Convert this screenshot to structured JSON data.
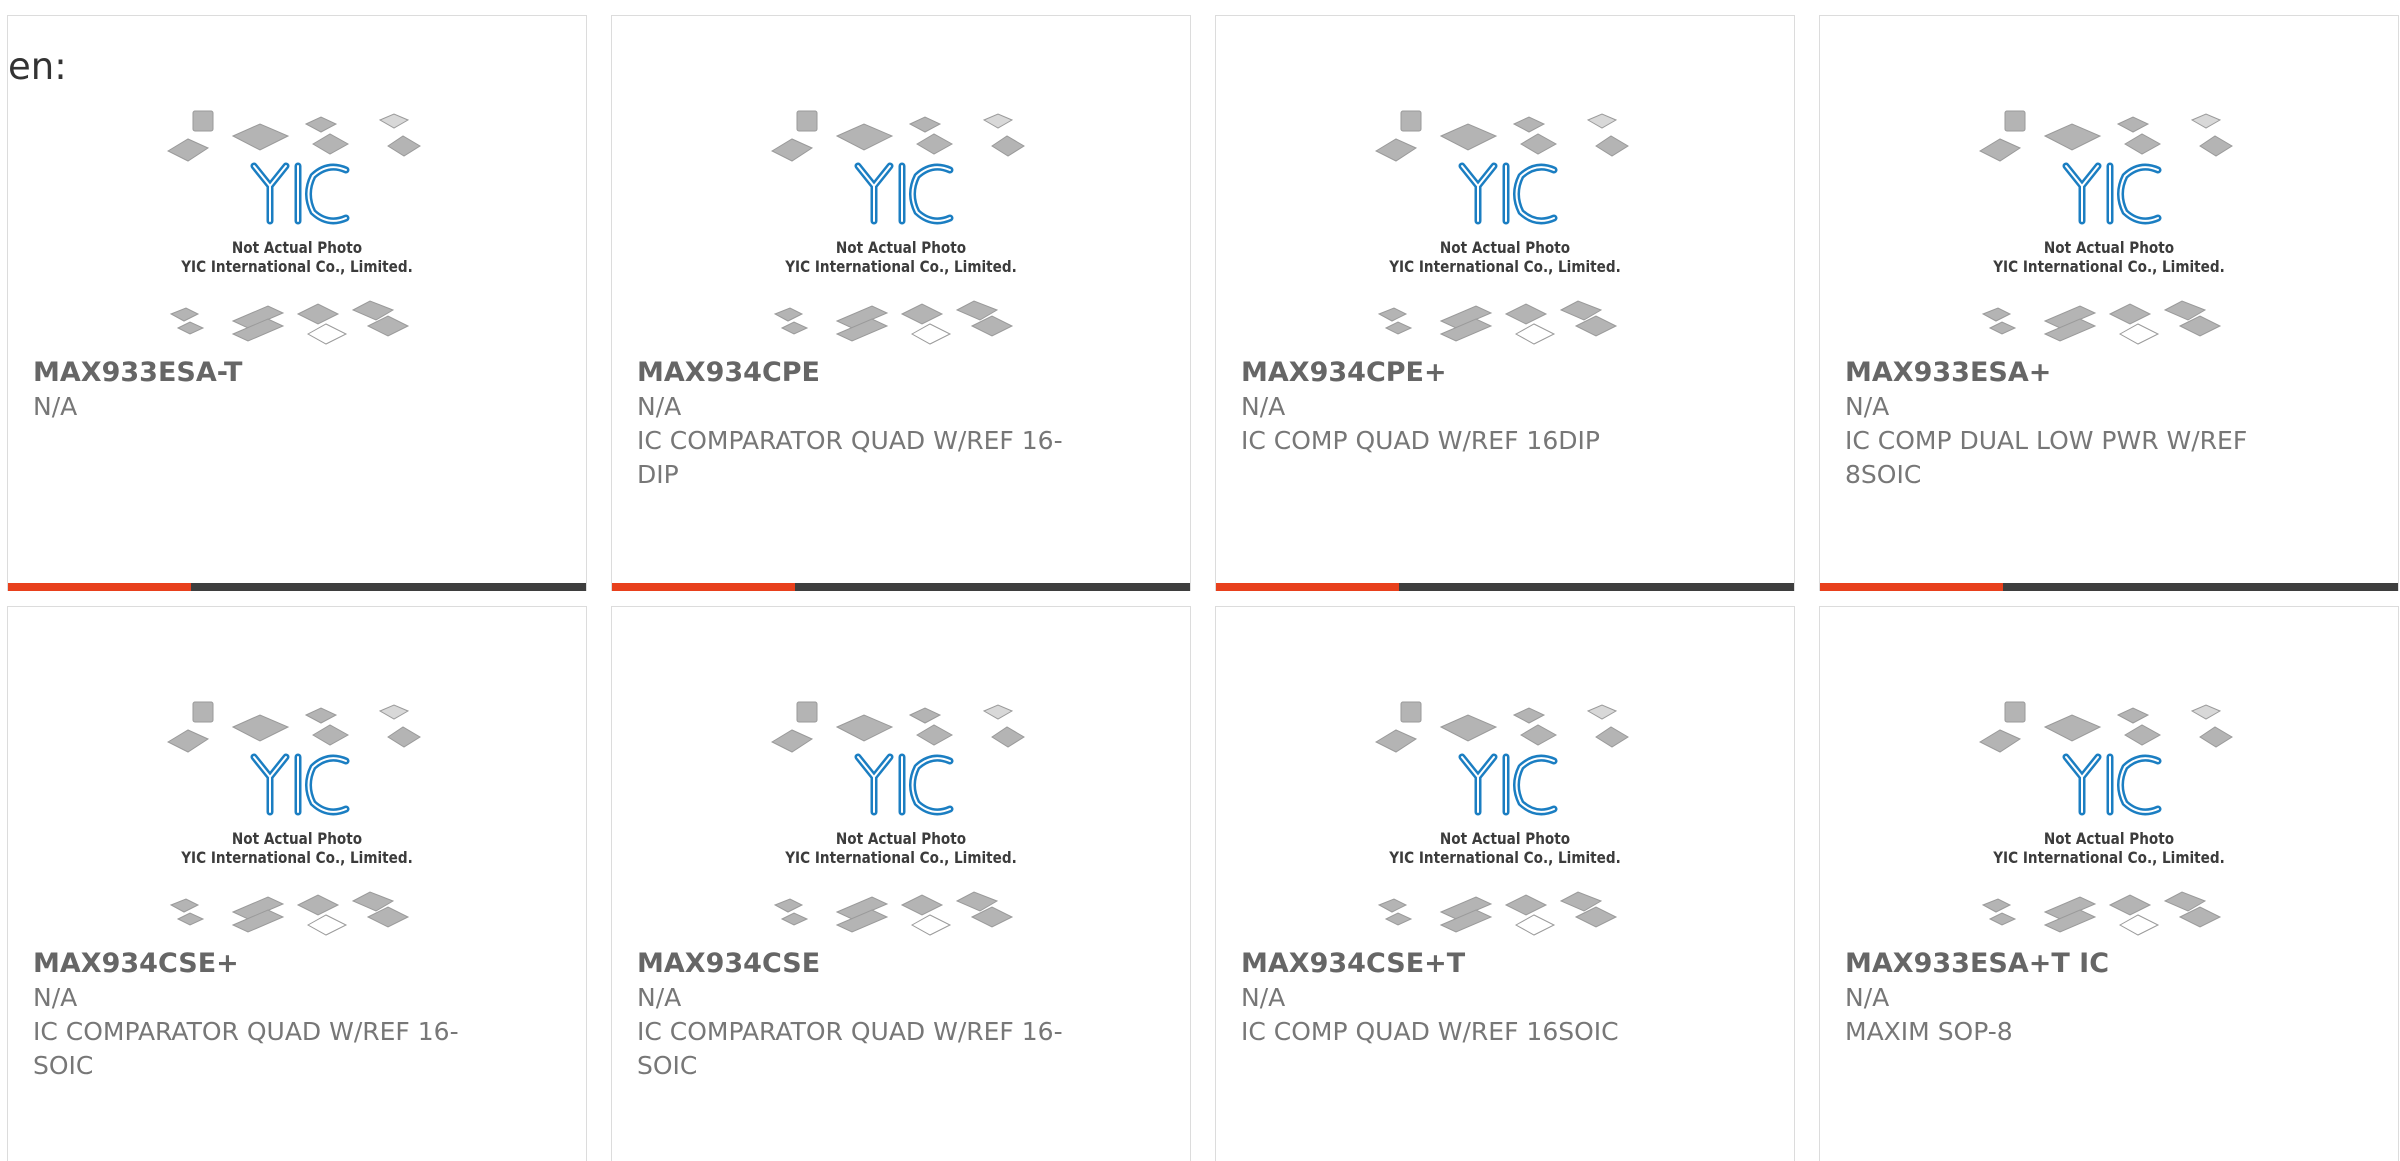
{
  "page": {
    "corner_text": "en:"
  },
  "theme": {
    "accent": "#e8401c",
    "bar": "#3e3e3e",
    "logo": "#1b7ec2"
  },
  "image": {
    "icon": "yic-logo-icon",
    "caption_line1": "Not Actual Photo",
    "caption_line2": "YIC International Co., Limited."
  },
  "products": [
    {
      "part": "MAX933ESA-T",
      "mfr": "N/A",
      "desc": ""
    },
    {
      "part": "MAX934CPE",
      "mfr": "N/A",
      "desc": "IC COMPARATOR QUAD W/REF 16-DIP"
    },
    {
      "part": "MAX934CPE+",
      "mfr": "N/A",
      "desc": "IC COMP QUAD W/REF 16DIP"
    },
    {
      "part": "MAX933ESA+",
      "mfr": "N/A",
      "desc": "IC COMP DUAL LOW PWR W/REF 8SOIC"
    },
    {
      "part": "MAX934CSE+",
      "mfr": "N/A",
      "desc": "IC COMPARATOR QUAD W/REF 16-SOIC"
    },
    {
      "part": "MAX934CSE",
      "mfr": "N/A",
      "desc": "IC COMPARATOR QUAD W/REF 16-SOIC"
    },
    {
      "part": "MAX934CSE+T",
      "mfr": "N/A",
      "desc": "IC COMP QUAD W/REF 16SOIC"
    },
    {
      "part": "MAX933ESA+T IC",
      "mfr": "N/A",
      "desc": "MAXIM SOP-8"
    }
  ]
}
